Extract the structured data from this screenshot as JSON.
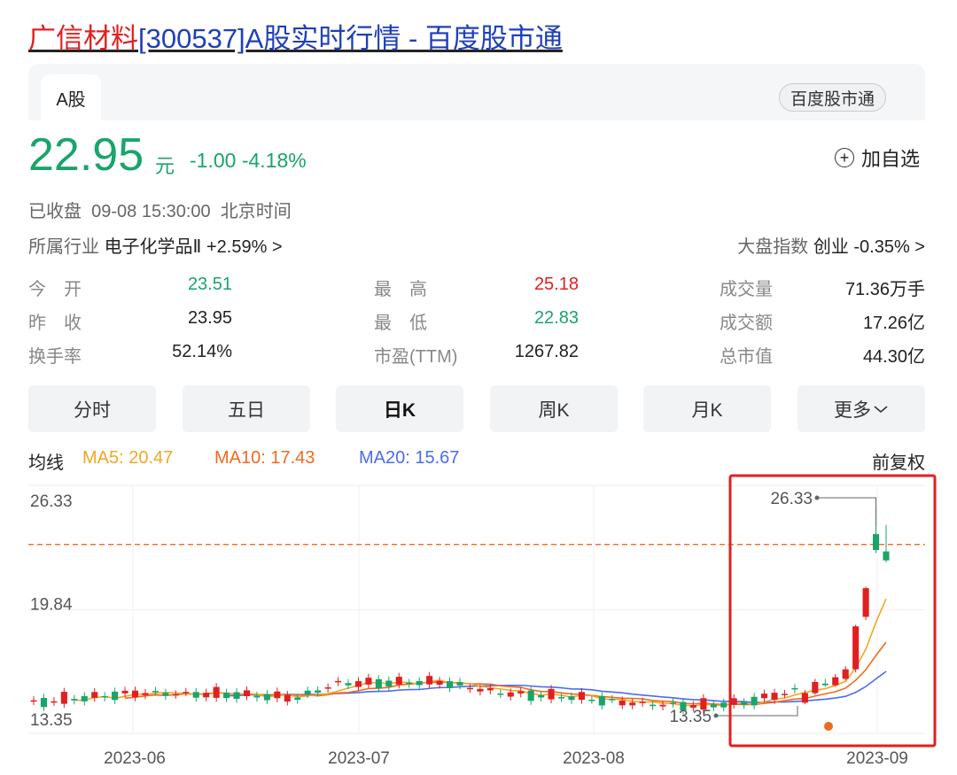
{
  "header": {
    "title_highlight": "广信材料",
    "title_rest": "[300537]A股实时行情 - 百度股市通",
    "tab": "A股",
    "badge": "百度股市通"
  },
  "quote": {
    "price": "22.95",
    "unit": "元",
    "change": "-1.00 -4.18%",
    "watch_label": "加自选",
    "status": "已收盘  09-08 15:30:00  北京时间",
    "industry_label": "所属行业",
    "industry_value": "电子化学品Ⅱ +2.59% >",
    "index_label": "大盘指数",
    "index_value": "创业 -0.35% >"
  },
  "stats": {
    "open_label": "今　开",
    "open": "23.51",
    "high_label": "最　高",
    "high": "25.18",
    "volume_label": "成交量",
    "volume": "71.36万手",
    "prev_label": "昨　收",
    "prev": "23.95",
    "low_label": "最　低",
    "low": "22.83",
    "amount_label": "成交额",
    "amount": "17.26亿",
    "turnover_label": "换手率",
    "turnover": "52.14%",
    "pe_label": "市盈(TTM)",
    "pe": "1267.82",
    "mcap_label": "总市值",
    "mcap": "44.30亿"
  },
  "periods": [
    "分时",
    "五日",
    "日K",
    "周K",
    "月K",
    "更多"
  ],
  "active_period": "日K",
  "ma": {
    "label": "均线",
    "ma5": "MA5: 20.47",
    "ma10": "MA10: 17.43",
    "ma20": "MA20: 15.67",
    "adjust": "前复权"
  },
  "colors": {
    "up": "#e02020",
    "down": "#1aa46b",
    "ma5": "#f5a623",
    "ma10": "#f06a1e",
    "ma20": "#4a6cf0",
    "highlight_box": "#e02020"
  },
  "chart_data": {
    "type": "candlestick",
    "y_ticks": [
      "26.33",
      "19.84",
      "13.35"
    ],
    "ylim": [
      13.35,
      26.33
    ],
    "x_ticks": [
      "2023-06",
      "2023-07",
      "2023-08",
      "2023-09"
    ],
    "reference_line": 23.95,
    "max_label": "26.33",
    "min_label": "13.35",
    "series_ma": {
      "ma5_last": 20.47,
      "ma10_last": 17.43,
      "ma20_last": 15.67
    },
    "recent_candles": [
      {
        "o": 14.0,
        "c": 14.6,
        "h": 14.8,
        "l": 13.9
      },
      {
        "o": 14.6,
        "c": 15.3,
        "h": 15.5,
        "l": 14.5
      },
      {
        "o": 15.2,
        "c": 15.1,
        "h": 15.5,
        "l": 15.0
      },
      {
        "o": 15.1,
        "c": 15.6,
        "h": 15.8,
        "l": 15.0
      },
      {
        "o": 15.5,
        "c": 16.1,
        "h": 16.3,
        "l": 15.4
      },
      {
        "o": 16.1,
        "c": 18.8,
        "h": 18.9,
        "l": 15.9
      },
      {
        "o": 19.4,
        "c": 21.2,
        "h": 21.3,
        "l": 19.2
      },
      {
        "o": 24.6,
        "c": 23.6,
        "h": 26.33,
        "l": 23.4
      },
      {
        "o": 23.51,
        "c": 22.95,
        "h": 25.18,
        "l": 22.83
      }
    ]
  }
}
